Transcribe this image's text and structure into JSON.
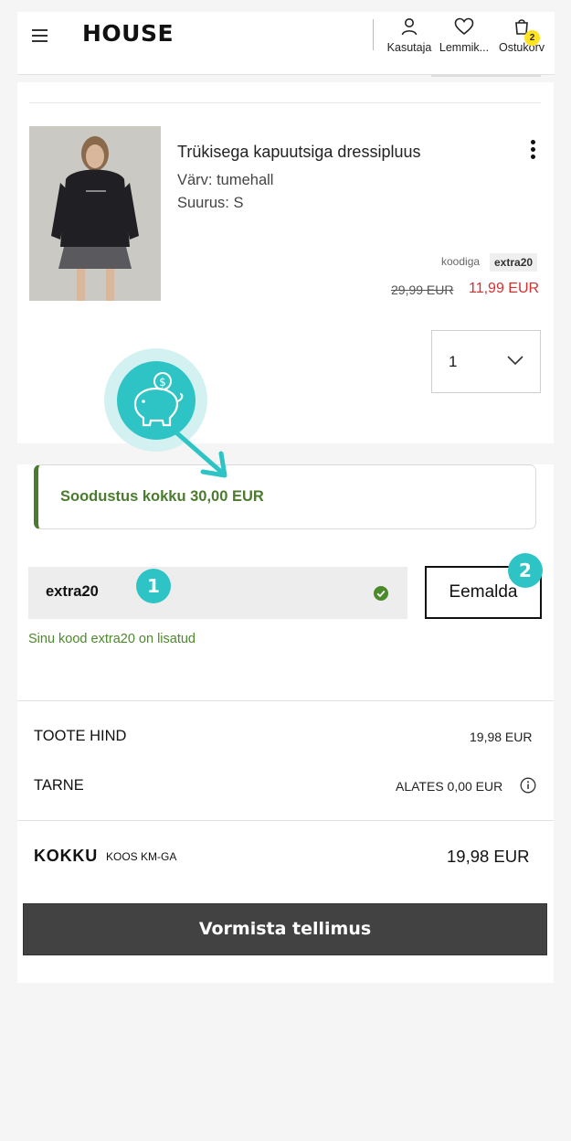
{
  "header": {
    "logo": "HOUSE",
    "menu_icon": "hamburger-menu-icon",
    "account_label": "Kasutaja",
    "favorites_label": "Lemmik...",
    "cart_label": "Ostukorv",
    "cart_count": "2"
  },
  "product": {
    "title": "Trükisega kapuutsiga dressipluus",
    "color": "Värv: tumehall",
    "size": "Suurus: S",
    "code_label": "koodiga",
    "code": "extra20",
    "old_price": "29,99 EUR",
    "new_price": "11,99 EUR",
    "quantity": "1"
  },
  "discount": {
    "text": "Soodustus kokku 30,00 EUR"
  },
  "promo": {
    "code_value": "extra20",
    "remove_label": "Eemalda",
    "success_note": "Sinu kood extra20 on lisatud"
  },
  "summary": {
    "product_price_label": "TOOTE HIND",
    "product_price_value": "19,98 EUR",
    "shipping_label": "TARNE",
    "shipping_value": "ALATES 0,00 EUR",
    "total_label": "KOKKU",
    "total_sub": "KOOS KM-GA",
    "total_value": "19,98 EUR"
  },
  "checkout": {
    "label": "Vormista tellimus"
  },
  "annotations": {
    "badge_1": "1",
    "badge_2": "2"
  },
  "colors": {
    "accent_teal": "#2ec4c6",
    "discount_green": "#4b7b2e",
    "sale_red": "#d33030",
    "badge_yellow": "#ffe41f",
    "checkout_dark": "#424242"
  }
}
